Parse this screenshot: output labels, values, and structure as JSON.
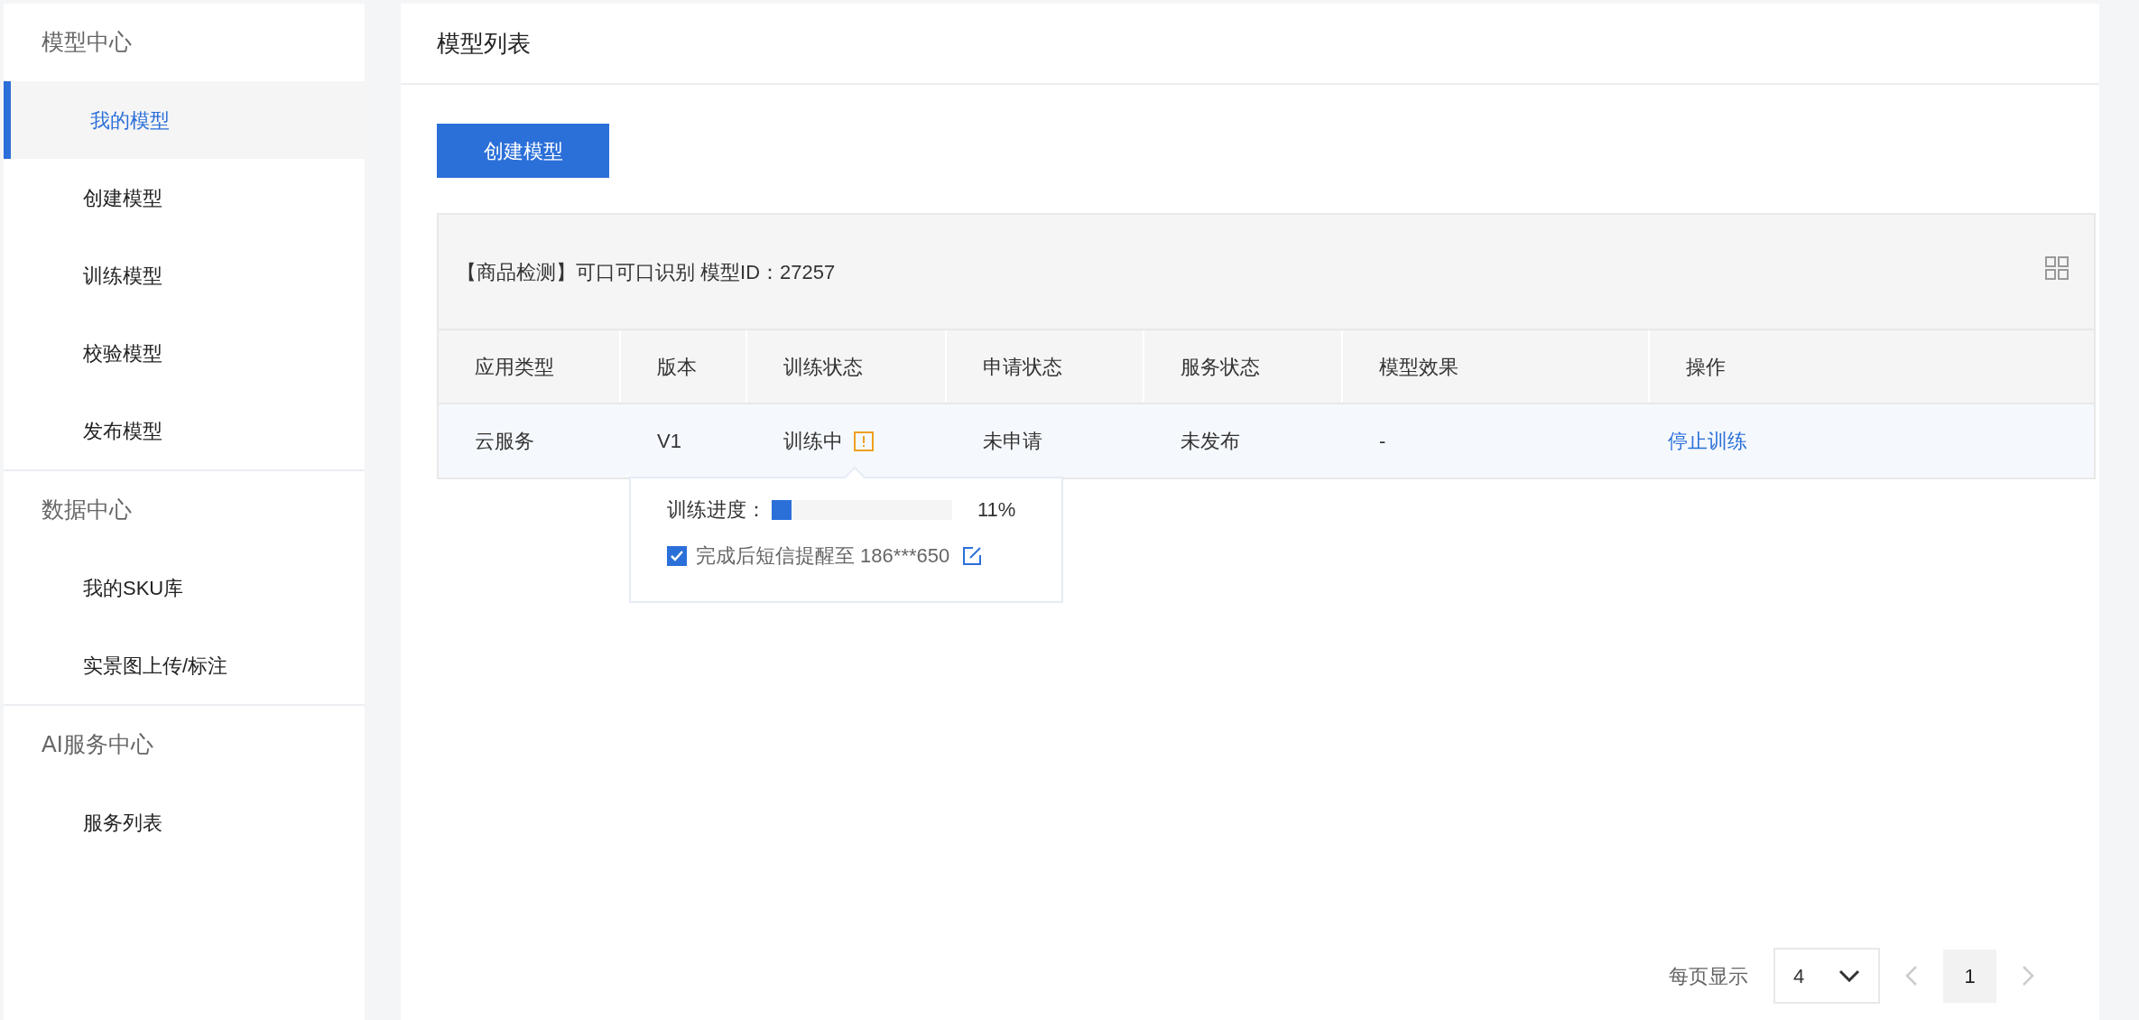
{
  "sidebar": {
    "groups": [
      {
        "title": "模型中心",
        "items": [
          {
            "label": "我的模型",
            "selected": true
          },
          {
            "label": "创建模型",
            "selected": false
          },
          {
            "label": "训练模型",
            "selected": false
          },
          {
            "label": "校验模型",
            "selected": false
          },
          {
            "label": "发布模型",
            "selected": false
          }
        ]
      },
      {
        "title": "数据中心",
        "items": [
          {
            "label": "我的SKU库",
            "selected": false
          },
          {
            "label": "实景图上传/标注",
            "selected": false
          }
        ]
      },
      {
        "title": "AI服务中心",
        "items": [
          {
            "label": "服务列表",
            "selected": false
          }
        ]
      }
    ]
  },
  "page": {
    "title": "模型列表",
    "create_button": "创建模型"
  },
  "model_card": {
    "title": "【商品检测】可口可口识别 模型ID：27257",
    "columns": [
      "应用类型",
      "版本",
      "训练状态",
      "申请状态",
      "服务状态",
      "模型效果",
      "操作"
    ],
    "rows": [
      {
        "app_type": "云服务",
        "version": "V1",
        "training_status": "训练中",
        "apply_status": "未申请",
        "service_status": "未发布",
        "effect": "-",
        "action": "停止训练",
        "warning": true
      }
    ]
  },
  "popover": {
    "progress_label": "训练进度：",
    "level": 0.11,
    "progress_text": "11%",
    "sms_checked": true,
    "sms_label": "完成后短信提醒至 186***650"
  },
  "pagination": {
    "label": "每页显示",
    "page_size": "4",
    "pages": [
      {
        "label": "1",
        "selected": true
      }
    ]
  }
}
